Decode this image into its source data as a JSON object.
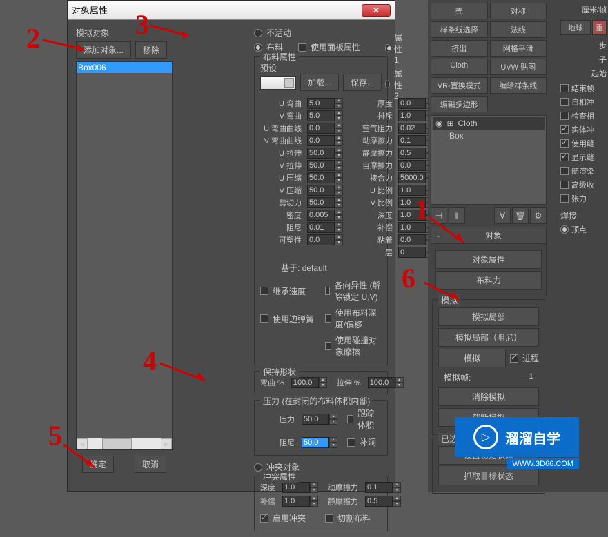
{
  "dialog": {
    "title": "对象属性",
    "sim_object_label": "模拟对象",
    "add_object": "添加对象...",
    "remove": "移除",
    "list_item": "Box006",
    "ok": "确定",
    "cancel": "取消"
  },
  "object_type": {
    "inactive": "不活动",
    "cloth": "布料",
    "use_panel_props": "使用面板属性",
    "collision": "冲突对象",
    "property1": "属性 1",
    "property2": "属性 2"
  },
  "cloth_props": {
    "legend": "布料属性",
    "preset_label": "预设",
    "load": "加载...",
    "save": "保存...",
    "params": {
      "u_bend": "U 弯曲",
      "u_bend_v": "5.0",
      "v_bend": "V 弯曲",
      "v_bend_v": "5.0",
      "u_bend_curve": "U 弯曲曲线",
      "u_bend_curve_v": "0.0",
      "v_bend_curve": "V 弯曲曲线",
      "v_bend_curve_v": "0.0",
      "u_stretch": "U 拉伸",
      "u_stretch_v": "50.0",
      "v_stretch": "V 拉伸",
      "v_stretch_v": "50.0",
      "u_compress": "U 压缩",
      "u_compress_v": "50.0",
      "v_compress": "V 压缩",
      "v_compress_v": "50.0",
      "shear": "剪切力",
      "shear_v": "50.0",
      "density": "密度",
      "density_v": "0.005",
      "damping": "阻尼",
      "damping_v": "0.01",
      "plasticity": "可塑性",
      "plasticity_v": "0.0",
      "thickness": "厚度",
      "thickness_v": "0.0",
      "repulsion": "排斥",
      "repulsion_v": "1.0",
      "air_res": "空气阻力",
      "air_res_v": "0.02",
      "dyn_fric": "动摩擦力",
      "dyn_fric_v": "0.1",
      "static_fric": "静摩擦力",
      "static_fric_v": "0.5",
      "self_fric": "自摩擦力",
      "self_fric_v": "0.0",
      "seam_force": "接合力",
      "seam_force_v": "5000.0",
      "u_scale": "U 比例",
      "u_scale_v": "1.0",
      "v_scale": "V 比例",
      "v_scale_v": "1.0",
      "depth": "深度",
      "depth_v": "1.0",
      "offset": "补偿",
      "offset_v": "1.0",
      "cling": "粘着",
      "cling_v": "0.0",
      "layer": "层",
      "layer_v": "0"
    },
    "based_on_label": "基于:",
    "based_on_value": "default",
    "inherit_velocity": "继承速度",
    "use_edge_springs": "使用边弹簧",
    "anisotropic": "各向异性 (解除锁定 U,V)",
    "use_cloth_depth": "使用布料深度/偏移",
    "use_collision_fric": "使用碰撞对象摩擦"
  },
  "keep_shape": {
    "legend": "保持形状",
    "bend_pct": "弯曲 %",
    "bend_v": "100.0",
    "stretch_pct": "拉伸 %",
    "stretch_v": "100.0"
  },
  "pressure": {
    "legend": "压力 (在封闭的布料体积内部)",
    "pressure": "压力",
    "pressure_v": "50.0",
    "damping": "阻尼",
    "damping_v": "50.0",
    "track_volume": "跟踪体积",
    "fill_holes": "补洞"
  },
  "collision_props": {
    "legend": "冲突属性",
    "depth": "深度",
    "depth_v": "1.0",
    "offset": "补偿",
    "offset_v": "1.0",
    "dyn_fric": "动摩擦力",
    "dyn_fric_v": "0.1",
    "static_fric": "静摩擦力",
    "static_fric_v": "0.5",
    "enable_collision": "启用冲突",
    "cut_cloth": "切割布料"
  },
  "right_panel": {
    "btns": {
      "shell": "壳",
      "symmetry": "对称",
      "spline_select": "样条线选择",
      "normals": "法线",
      "extrude": "挤出",
      "mesh_smooth": "网格平滑",
      "cloth": "Cloth",
      "uvw_map": "UVW 贴图",
      "vr_displace": "VR-置换模式",
      "edit_spline": "编辑样条线",
      "edit_poly": "编辑多边形"
    },
    "tree_root": "Cloth",
    "tree_child": "Box",
    "rollout_object": "对象",
    "object_props_btn": "对象属性",
    "cloth_force_btn": "布料力",
    "rollout_sim": "模拟",
    "sim_local": "模拟局部",
    "sim_local_damped": "模拟局部（阻尼）",
    "simulate": "模拟",
    "progress": "进程",
    "sim_frame_label": "模拟帧:",
    "sim_frame_value": "1",
    "erase_sim": "消除模拟",
    "truncate_sim": "截断模拟",
    "selected_manipulators": "已选的对象操纵器",
    "set_initial_state": "设置初始状态",
    "grab_target_state": "抓取目标状态"
  },
  "far_right": {
    "unit": "厘米/帧",
    "earth": "地球",
    "heavy": "重",
    "step": "步",
    "sub": "子",
    "start": "起始",
    "end_frame": "结束帧",
    "self_collide": "自相冲",
    "check_inter": "检查相",
    "solid_collide": "实体冲",
    "use_sew": "使用缝",
    "show_sew": "显示缝",
    "random_dye": "随渲染",
    "advanced": "高级收",
    "tension": "张力",
    "weld": "焊接",
    "vertex": "顶点"
  },
  "watermark": {
    "main": "溜溜自学",
    "sub": "WWW.3D66.COM"
  },
  "annotations": {
    "n1": "1",
    "n2": "2",
    "n3": "3",
    "n4": "4",
    "n5": "5",
    "n6": "6"
  }
}
